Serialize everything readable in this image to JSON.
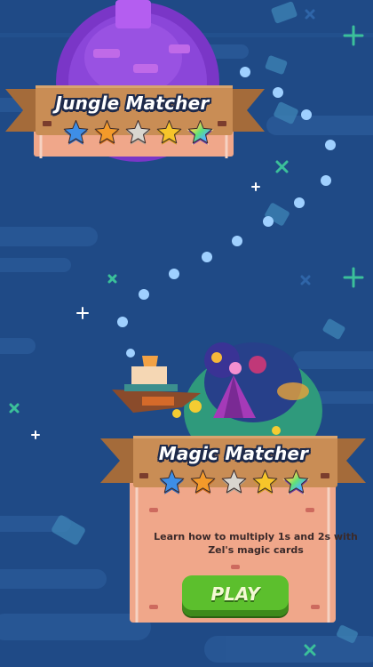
{
  "levels": [
    {
      "title": "Jungle Matcher",
      "stars": [
        "blue",
        "orange",
        "silver",
        "gold",
        "rainbow"
      ]
    },
    {
      "title": "Magic Matcher",
      "stars": [
        "blue",
        "orange",
        "silver",
        "gold",
        "rainbow"
      ],
      "description": "Learn how to multiply 1s and 2s with Zel's magic cards",
      "play_label": "PLAY"
    }
  ],
  "colors": {
    "background": "#1f4a86",
    "ribbon": "#c98d55",
    "board": "#f0a78a",
    "play_button": "#5cbf2d",
    "path_dots": "#9fd0ff",
    "accent_cross": "#3bc09a"
  },
  "icons": {
    "star_blue": "star-icon",
    "star_orange": "star-icon",
    "star_silver": "star-icon",
    "star_gold": "star-icon",
    "star_rainbow": "star-icon"
  }
}
